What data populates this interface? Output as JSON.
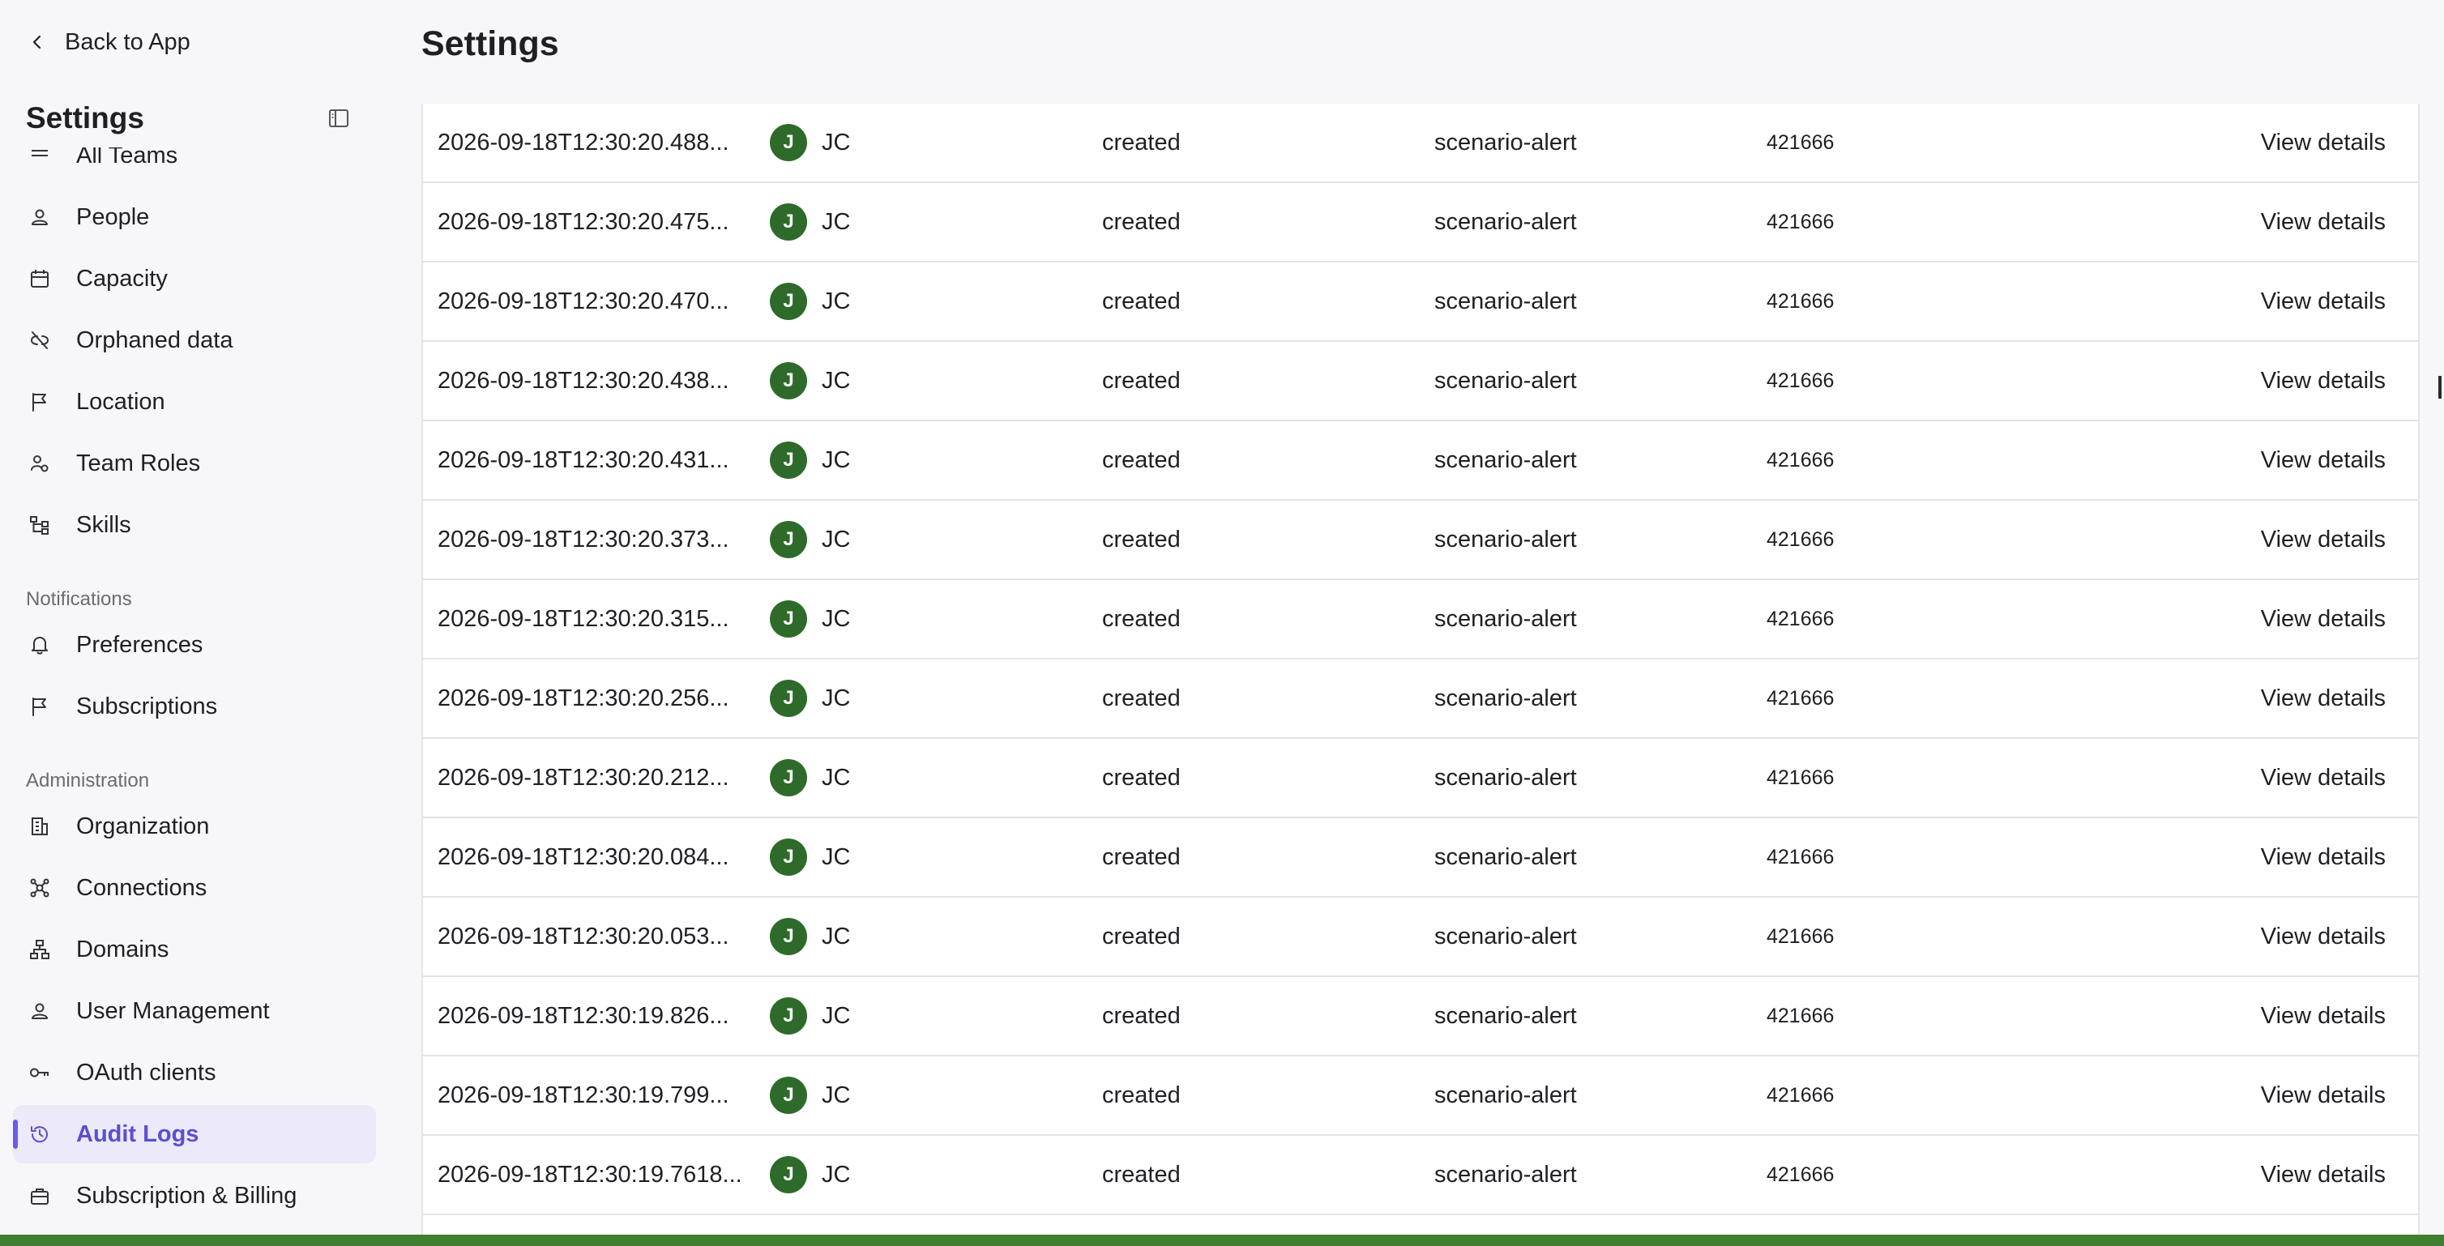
{
  "header": {
    "back_label": "Back to App",
    "sidebar_title": "Settings",
    "page_title": "Settings"
  },
  "sidebar": {
    "cut_item": "All Teams",
    "workspace_items": [
      {
        "label": "People",
        "icon": "person-icon"
      },
      {
        "label": "Capacity",
        "icon": "calendar-icon"
      },
      {
        "label": "Orphaned data",
        "icon": "unlink-icon"
      },
      {
        "label": "Location",
        "icon": "flag-icon"
      },
      {
        "label": "Team Roles",
        "icon": "team-roles-icon"
      },
      {
        "label": "Skills",
        "icon": "skills-tree-icon"
      }
    ],
    "notifications_heading": "Notifications",
    "notification_items": [
      {
        "label": "Preferences",
        "icon": "bell-icon"
      },
      {
        "label": "Subscriptions",
        "icon": "flag-icon"
      }
    ],
    "administration_heading": "Administration",
    "administration_items": [
      {
        "label": "Organization",
        "icon": "building-icon"
      },
      {
        "label": "Connections",
        "icon": "connections-icon"
      },
      {
        "label": "Domains",
        "icon": "sitemap-icon"
      },
      {
        "label": "User Management",
        "icon": "person-icon"
      },
      {
        "label": "OAuth clients",
        "icon": "key-icon"
      },
      {
        "label": "Audit Logs",
        "icon": "history-icon",
        "active": true
      },
      {
        "label": "Subscription & Billing",
        "icon": "briefcase-icon"
      }
    ]
  },
  "audit_rows": [
    {
      "timestamp": "2026-09-18T12:30:20.488...",
      "avatar": "J",
      "actor": "JC",
      "action": "created",
      "resource": "scenario-alert",
      "id": "421666",
      "link": "View details"
    },
    {
      "timestamp": "2026-09-18T12:30:20.475...",
      "avatar": "J",
      "actor": "JC",
      "action": "created",
      "resource": "scenario-alert",
      "id": "421666",
      "link": "View details"
    },
    {
      "timestamp": "2026-09-18T12:30:20.470...",
      "avatar": "J",
      "actor": "JC",
      "action": "created",
      "resource": "scenario-alert",
      "id": "421666",
      "link": "View details"
    },
    {
      "timestamp": "2026-09-18T12:30:20.438...",
      "avatar": "J",
      "actor": "JC",
      "action": "created",
      "resource": "scenario-alert",
      "id": "421666",
      "link": "View details"
    },
    {
      "timestamp": "2026-09-18T12:30:20.431...",
      "avatar": "J",
      "actor": "JC",
      "action": "created",
      "resource": "scenario-alert",
      "id": "421666",
      "link": "View details"
    },
    {
      "timestamp": "2026-09-18T12:30:20.373...",
      "avatar": "J",
      "actor": "JC",
      "action": "created",
      "resource": "scenario-alert",
      "id": "421666",
      "link": "View details"
    },
    {
      "timestamp": "2026-09-18T12:30:20.315...",
      "avatar": "J",
      "actor": "JC",
      "action": "created",
      "resource": "scenario-alert",
      "id": "421666",
      "link": "View details"
    },
    {
      "timestamp": "2026-09-18T12:30:20.256...",
      "avatar": "J",
      "actor": "JC",
      "action": "created",
      "resource": "scenario-alert",
      "id": "421666",
      "link": "View details"
    },
    {
      "timestamp": "2026-09-18T12:30:20.212...",
      "avatar": "J",
      "actor": "JC",
      "action": "created",
      "resource": "scenario-alert",
      "id": "421666",
      "link": "View details"
    },
    {
      "timestamp": "2026-09-18T12:30:20.084...",
      "avatar": "J",
      "actor": "JC",
      "action": "created",
      "resource": "scenario-alert",
      "id": "421666",
      "link": "View details"
    },
    {
      "timestamp": "2026-09-18T12:30:20.053...",
      "avatar": "J",
      "actor": "JC",
      "action": "created",
      "resource": "scenario-alert",
      "id": "421666",
      "link": "View details"
    },
    {
      "timestamp": "2026-09-18T12:30:19.826...",
      "avatar": "J",
      "actor": "JC",
      "action": "created",
      "resource": "scenario-alert",
      "id": "421666",
      "link": "View details"
    },
    {
      "timestamp": "2026-09-18T12:30:19.799...",
      "avatar": "J",
      "actor": "JC",
      "action": "created",
      "resource": "scenario-alert",
      "id": "421666",
      "link": "View details"
    },
    {
      "timestamp": "2026-09-18T12:30:19.7618...",
      "avatar": "J",
      "actor": "JC",
      "action": "created",
      "resource": "scenario-alert",
      "id": "421666",
      "link": "View details"
    }
  ],
  "colors": {
    "accent": "#6b5ce7",
    "active_bg": "#ebe9fa",
    "avatar_bg": "#2e6b2a",
    "border": "#e3e3e8"
  }
}
